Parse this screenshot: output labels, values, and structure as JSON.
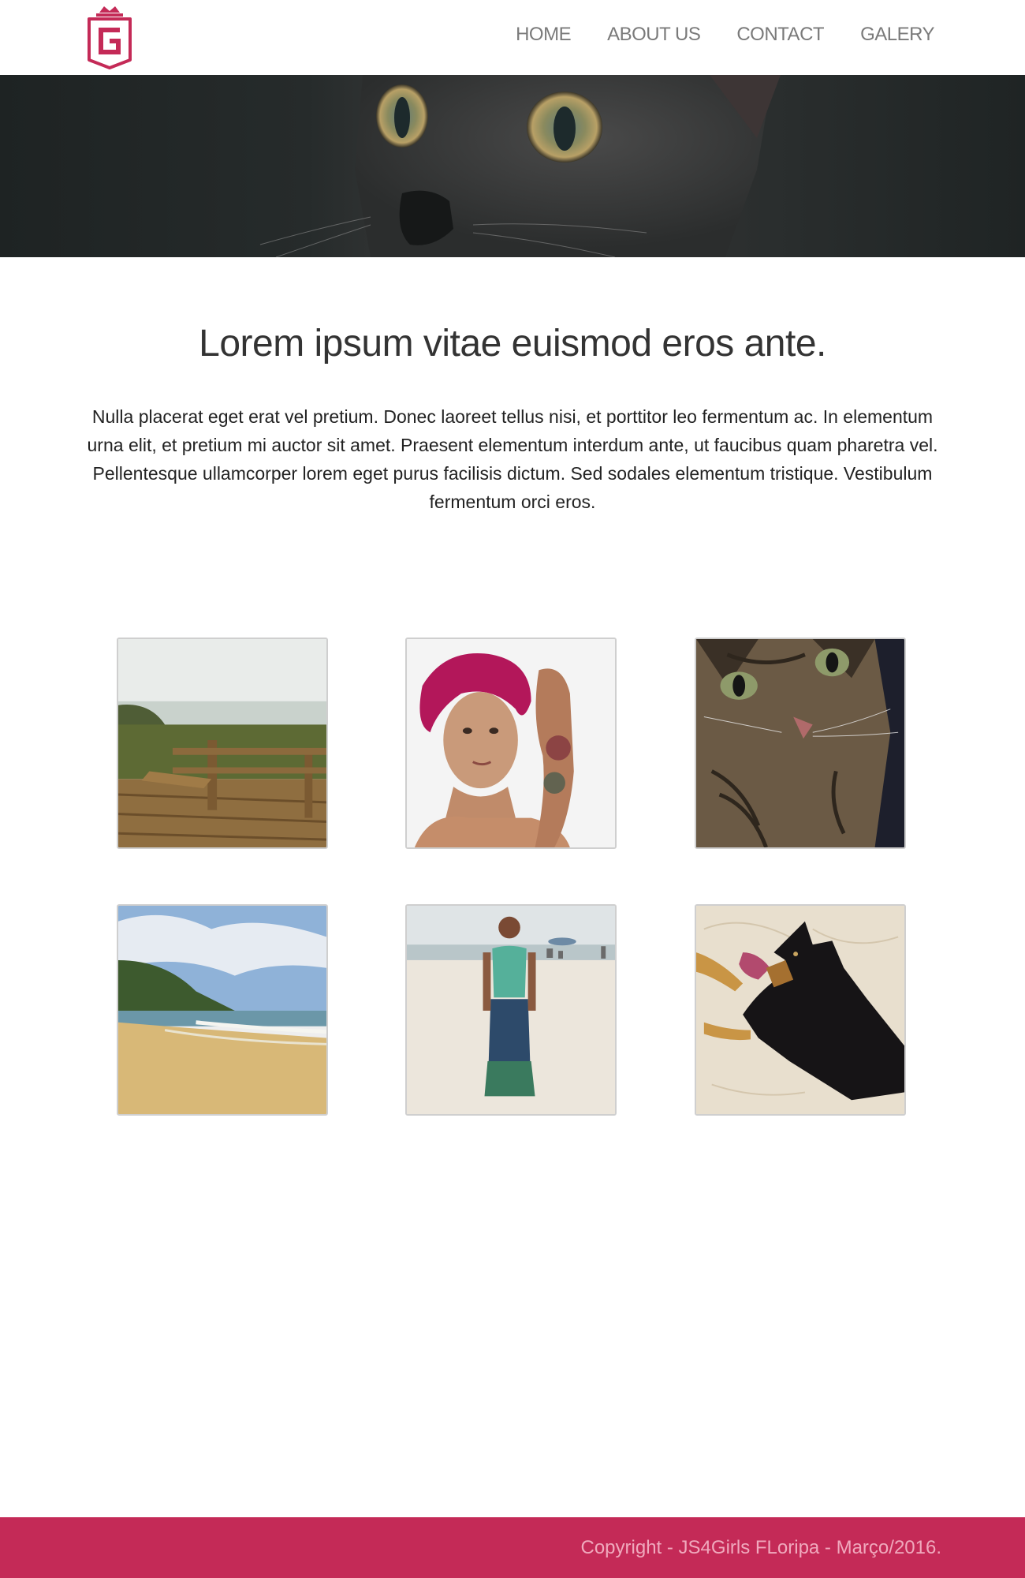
{
  "brand": {
    "logo_icon": "g-crown-logo-icon",
    "accent": "#c42a57"
  },
  "nav": {
    "items": [
      {
        "label": "HOME"
      },
      {
        "label": "ABOUT US"
      },
      {
        "label": "CONTACT"
      },
      {
        "label": "GALERY"
      }
    ]
  },
  "hero": {
    "image": "black-cat-closeup-banner"
  },
  "main": {
    "headline": "Lorem ipsum vitae euismod eros ante.",
    "paragraph": "Nulla placerat eget erat vel pretium. Donec laoreet tellus nisi, et porttitor leo fermentum ac. In elementum urna elit, et pretium mi auctor sit amet. Praesent elementum interdum ante, ut faucibus quam pharetra vel. Pellentesque ullamcorper lorem eget purus facilisis dictum. Sed sodales elementum tristique. Vestibulum fermentum orci eros."
  },
  "gallery": {
    "photos": [
      {
        "subject": "beach-boardwalk-bench"
      },
      {
        "subject": "woman-pink-hair-portrait"
      },
      {
        "subject": "tabby-cat-closeup"
      },
      {
        "subject": "beach-shoreline-hill"
      },
      {
        "subject": "woman-on-beach"
      },
      {
        "subject": "dog-in-sand"
      }
    ]
  },
  "footer": {
    "copyright": "Copyright - JS4Girls FLoripa - Março/2016."
  }
}
